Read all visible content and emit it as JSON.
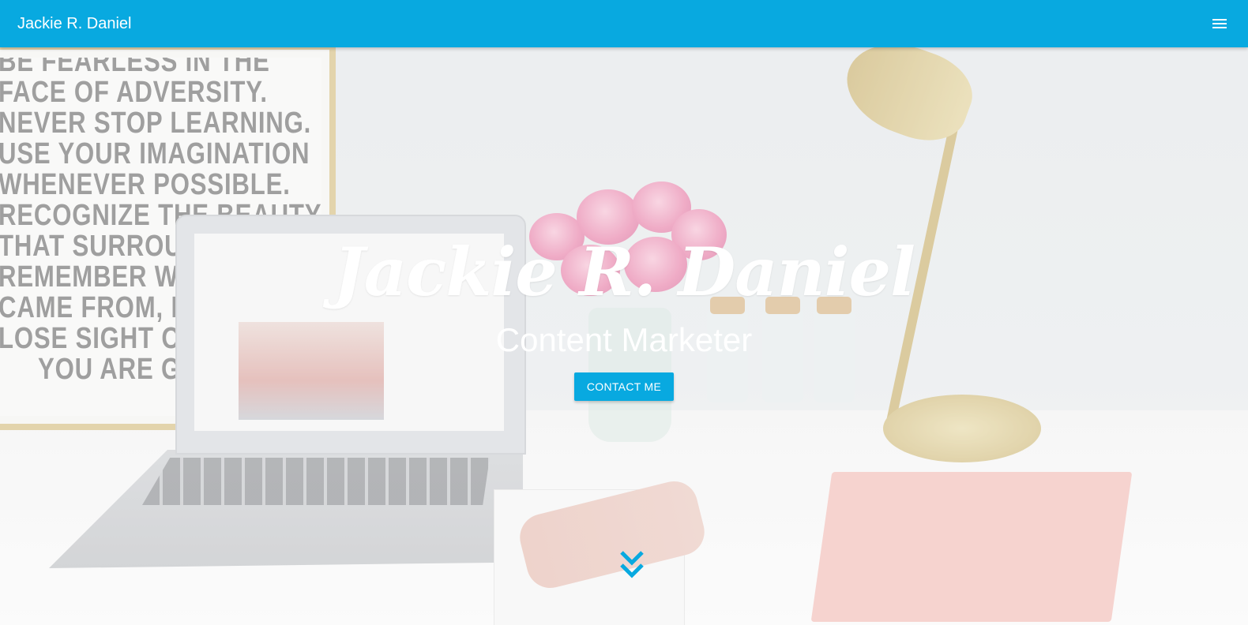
{
  "appbar": {
    "brand": "Jackie R. Daniel",
    "menu_icon": "hamburger-menu-icon",
    "background_color": "#08a9e0"
  },
  "hero": {
    "title": "Jackie R. Daniel",
    "subtitle": "Content Marketer",
    "cta_label": "CONTACT ME",
    "scroll_icon": "double-chevron-down-icon",
    "accent_color": "#08a9e0"
  },
  "background_photo": {
    "poster_lines": [
      "BE FEARLESS IN THE",
      "FACE OF ADVERSITY.",
      "NEVER STOP LEARNING.",
      "USE YOUR IMAGINATION",
      "WHENEVER POSSIBLE.",
      "RECOGNIZE THE BEAUTY",
      "THAT SURROUNDS YOU.",
      "REMEMBER WHERE YOU",
      "CAME FROM, BUT NEVER",
      "LOSE SIGHT OF WHERE",
      "YOU ARE GOING."
    ]
  }
}
